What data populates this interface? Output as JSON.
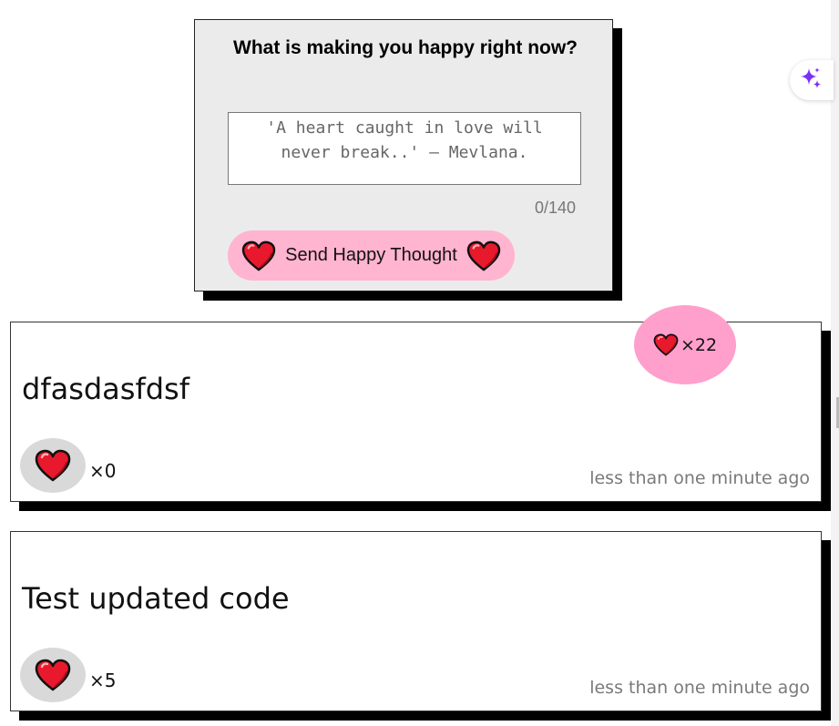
{
  "form": {
    "title": "What is making you happy right now?",
    "placeholder": "'A heart caught in love will never break..' – Mevlana.",
    "char_count": "0/140",
    "send_label": "Send Happy Thought",
    "send_icon": "heart-icon"
  },
  "total_likes": {
    "label": "×22",
    "icon": "heart-icon"
  },
  "thoughts": [
    {
      "message": "dfasdasfdsf",
      "likes": "×0",
      "time": "less than one minute ago"
    },
    {
      "message": "Test updated code",
      "likes": "×5",
      "time": "less than one minute ago"
    }
  ],
  "side_button": {
    "icon": "sparkle-icon"
  },
  "colors": {
    "form_bg": "#ebebeb",
    "send_button": "#ffb4cf",
    "bubble": "#ff9fcc",
    "heart": "#e8192c",
    "like_button": "#d9d9d9",
    "sparkle": "#7b2ff7"
  }
}
